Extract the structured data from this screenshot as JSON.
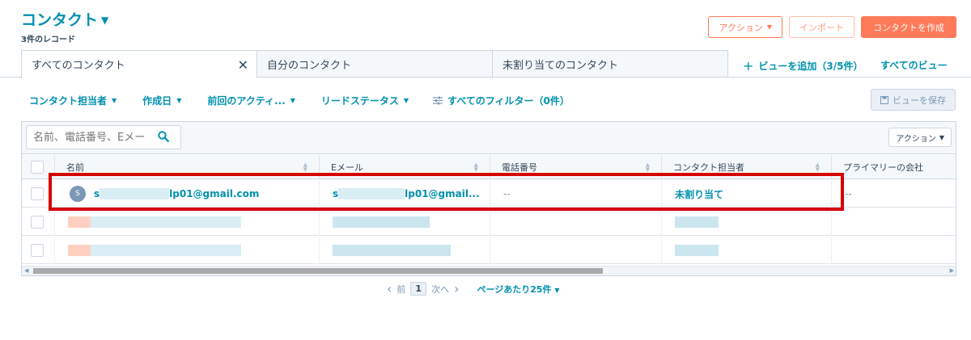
{
  "header": {
    "title": "コンタクト",
    "record_count": "3件のレコード"
  },
  "top_actions": {
    "actions": "アクション",
    "import": "インポート",
    "create": "コンタクトを作成"
  },
  "tabs": [
    {
      "label": "すべてのコンタクト"
    },
    {
      "label": "自分のコンタクト"
    },
    {
      "label": "未割り当てのコンタクト"
    }
  ],
  "add_view": "ビューを追加（3/5件）",
  "all_views": "すべてのビュー",
  "filters": {
    "owner": "コンタクト担当者",
    "created": "作成日",
    "last_activity": "前回のアクティ...",
    "lead_status": "リードステータス",
    "all_filters": "すべてのフィルター（0件）"
  },
  "save_view": "ビューを保存",
  "table": {
    "search_placeholder": "名前、電話番号、Eメー",
    "actions": "アクション",
    "columns": [
      "名前",
      "Eメール",
      "電話番号",
      "コンタクト担当者",
      "プライマリーの会社"
    ],
    "rows": [
      {
        "avatar": "S",
        "name_start": "s",
        "name_end": "lp01@gmail.com",
        "email_start": "s",
        "email_end": "lp01@gmail...",
        "phone": "--",
        "owner": "未割り当て",
        "company": "--"
      }
    ]
  },
  "pagination": {
    "prev": "前",
    "current": "1",
    "next": "次へ",
    "per_page": "ページあたり25件"
  },
  "colors": {
    "accent": "#0091ae",
    "brand": "#ff7a59",
    "highlight": "#d60000"
  }
}
